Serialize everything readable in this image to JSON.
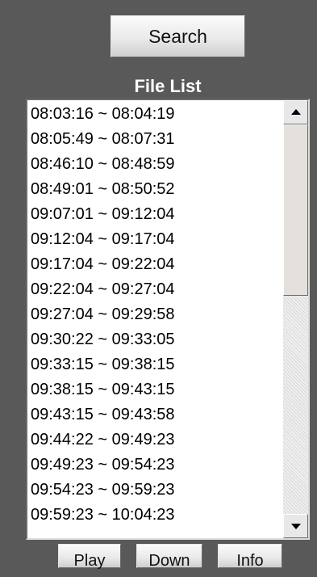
{
  "toolbar": {
    "search_label": "Search"
  },
  "file_list": {
    "title": "File List",
    "items": [
      "08:03:16 ~ 08:04:19",
      "08:05:49 ~ 08:07:31",
      "08:46:10 ~ 08:48:59",
      "08:49:01 ~ 08:50:52",
      "09:07:01 ~ 09:12:04",
      "09:12:04 ~ 09:17:04",
      "09:17:04 ~ 09:22:04",
      "09:22:04 ~ 09:27:04",
      "09:27:04 ~ 09:29:58",
      "09:30:22 ~ 09:33:05",
      "09:33:15 ~ 09:38:15",
      "09:38:15 ~ 09:43:15",
      "09:43:15 ~ 09:43:58",
      "09:44:22 ~ 09:49:23",
      "09:49:23 ~ 09:54:23",
      "09:54:23 ~ 09:59:23",
      "09:59:23 ~ 10:04:23"
    ]
  },
  "actions": {
    "play_label": "Play",
    "down_label": "Down",
    "info_label": "Info"
  },
  "colors": {
    "background": "#595959",
    "list_background": "#ffffff",
    "title_text": "#ffffff"
  },
  "icons": {
    "scroll_up": "triangle-up-icon",
    "scroll_down": "triangle-down-icon"
  }
}
